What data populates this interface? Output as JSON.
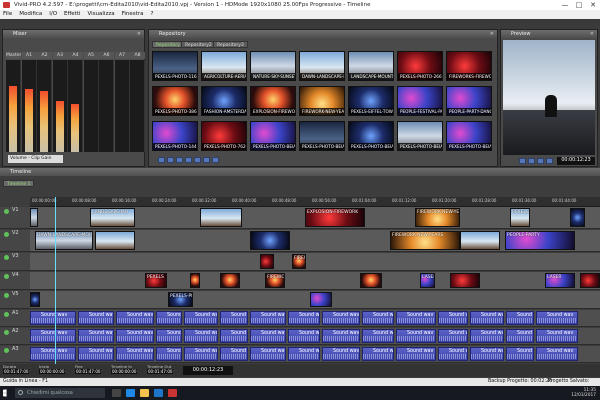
{
  "window": {
    "title": "Vivid-PRO 4.2.597 - E:\\progetti\\cm-Edita2010\\vid-Edita2010.vpj - Version 1 - HDMode 1920x1080 25.00Fps Progressive - Timeline",
    "controls": [
      "—",
      "□",
      "✕"
    ]
  },
  "menu": [
    "File",
    "Modifica",
    "I/O",
    "Effetti",
    "Visualizza",
    "Finestra",
    "?"
  ],
  "mixer": {
    "title": "Mixer",
    "channels": [
      {
        "label": "Master",
        "level": 0.72
      },
      {
        "label": "A1",
        "level": 0.68
      },
      {
        "label": "A2",
        "level": 0.66
      },
      {
        "label": "A3",
        "level": 0.55
      },
      {
        "label": "A4",
        "level": 0.52
      },
      {
        "label": "A5",
        "level": 0.0
      },
      {
        "label": "A6",
        "level": 0.0
      },
      {
        "label": "A7",
        "level": 0.0
      },
      {
        "label": "A8",
        "level": 0.0
      }
    ],
    "select_value": "Volume - Clip Gain"
  },
  "repository": {
    "title": "Repository",
    "tabs": [
      "Repository",
      "Repository2",
      "Repository3"
    ],
    "items": [
      {
        "caption": "PEXELS-PHOTO-1165884",
        "tone": "grad-city"
      },
      {
        "caption": "AGRICOLTURE-AERIAL",
        "tone": "grad-sky"
      },
      {
        "caption": "NATURE-SKY-SUNSET-A",
        "tone": "grad-mount"
      },
      {
        "caption": "DAWN-LANDSCAPE-MO",
        "tone": "grad-sky"
      },
      {
        "caption": "LANDSCAPE-MOUNTAIN",
        "tone": "grad-mount"
      },
      {
        "caption": "PEXELS-PHOTO-266705",
        "tone": "grad-red"
      },
      {
        "caption": "FIREWORKS-FIREWORKS",
        "tone": "grad-red"
      },
      {
        "caption": "PEXELS-PHOTO-38614",
        "tone": "grad-fire"
      },
      {
        "caption": "FASHION-AMSTERDAM",
        "tone": "grad-dark"
      },
      {
        "caption": "EXPLOSION-FIREWORK",
        "tone": "grad-fire"
      },
      {
        "caption": "FIREWORK-NEW-YEARS",
        "tone": "grad-gold"
      },
      {
        "caption": "PEXELS-EIFFEL-TOWER",
        "tone": "grad-dark"
      },
      {
        "caption": "PEOPLE-FESTIVAL-PAR",
        "tone": "grad-party"
      },
      {
        "caption": "PEOPLE-PARTY-DANCING",
        "tone": "grad-party"
      },
      {
        "caption": "PEXELS-PHOTO-144",
        "tone": "grad-party"
      },
      {
        "caption": "PEXELS-PHOTO-76202",
        "tone": "grad-red"
      },
      {
        "caption": "PEXELS-PHOTO-BEIAR",
        "tone": "grad-party"
      },
      {
        "caption": "PEXELS-PHOTO-BEIAR",
        "tone": "grad-city"
      },
      {
        "caption": "PEXELS-PHOTO-BEIAR",
        "tone": "grad-dark"
      },
      {
        "caption": "PEXELS-PHOTO-BEIAR",
        "tone": "grad-mount"
      },
      {
        "caption": "PEXELS-PHOTO-BEIAR",
        "tone": "grad-party"
      }
    ]
  },
  "preview": {
    "title": "Preview",
    "timecode": "00:00:12:23"
  },
  "timeline": {
    "title": "Timeline",
    "tab": "Timeline 1",
    "ruler_ticks": [
      "00:00:00:00",
      "00:00:08:00",
      "00:00:16:00",
      "00:00:24:00",
      "00:00:32:00",
      "00:00:40:00",
      "00:00:48:00",
      "00:00:56:00",
      "00:01:04:00",
      "00:01:12:00",
      "00:01:20:00",
      "00:01:28:00",
      "00:01:36:00",
      "00:01:44:00"
    ],
    "tracks": [
      {
        "name": "V1"
      },
      {
        "name": "V2"
      },
      {
        "name": "V3"
      },
      {
        "name": "V4"
      },
      {
        "name": "V5"
      },
      {
        "name": "A1"
      },
      {
        "name": "A2"
      },
      {
        "name": "A3"
      }
    ],
    "video_clips": {
      "v1": [
        "LANDSCAPE-MO",
        "EXPLOSION-FIREWORK",
        "FIREWORK-NEW-YE",
        "PEXELS-PHOTO-14"
      ],
      "v2": [
        "DAWN-LANDSCAPE-MOUNTAIN",
        "FIREWORK-NEW-YEARS",
        "PEOPLE-PARTY"
      ],
      "v3": [
        "FIREWORK"
      ],
      "v4": [
        "PEXELS",
        "FIREWORK",
        "LASER",
        "LASER"
      ],
      "v5": [
        "PEXELS-PHOTO"
      ]
    },
    "audio_clip_label": "Sound wav",
    "position": "00:00:12:23",
    "timecodes": [
      {
        "label": "Durata",
        "value": "00:01:47:00"
      },
      {
        "label": "Inizio",
        "value": "00:00:00:00"
      },
      {
        "label": "Fine",
        "value": "00:01:47:00"
      },
      {
        "label": "Timeline In",
        "value": "00:00:00:00"
      },
      {
        "label": "Timeline Out",
        "value": "00:01:47:00"
      }
    ]
  },
  "statusbar": {
    "left": "Guida in Linea - F1",
    "backup": "Backup Progetto: 00:02:26",
    "save": "Progetto Salvato: 00:16:57"
  },
  "taskbar": {
    "search_placeholder": "Chiedimi qualcosa",
    "time": "11:35",
    "date": "12/03/2017"
  }
}
